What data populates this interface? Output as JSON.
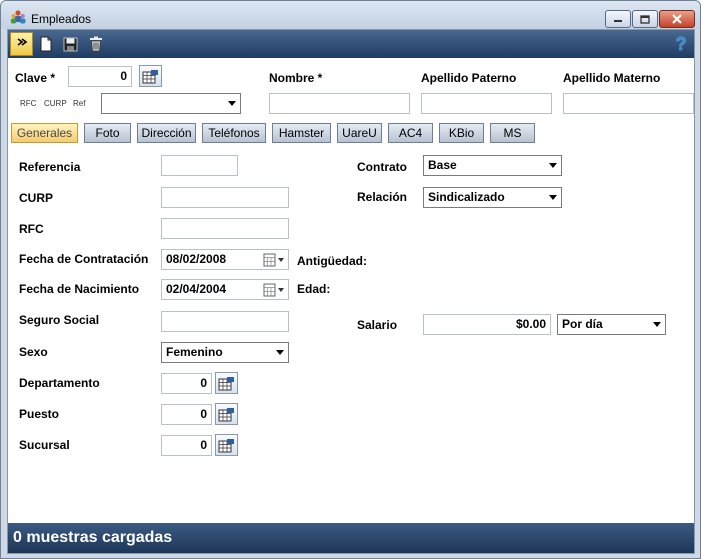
{
  "window": {
    "title": "Empleados"
  },
  "header": {
    "clave_label": "Clave *",
    "clave_value": "0",
    "nombre_label": "Nombre *",
    "apellido_paterno_label": "Apellido Paterno",
    "apellido_materno_label": "Apellido Materno",
    "rfc_tag": "RFC",
    "curp_tag": "CURP",
    "ref_tag": "Ref",
    "help_glyph": "?"
  },
  "tabs": [
    {
      "label": "Generales"
    },
    {
      "label": "Foto"
    },
    {
      "label": "Dirección"
    },
    {
      "label": "Teléfonos"
    },
    {
      "label": "Hamster"
    },
    {
      "label": "UareU"
    },
    {
      "label": "AC4"
    },
    {
      "label": "KBio"
    },
    {
      "label": "MS"
    }
  ],
  "form": {
    "referencia_label": "Referencia",
    "curp_label": "CURP",
    "rfc_label": "RFC",
    "fecha_contratacion_label": "Fecha de Contratación",
    "fecha_contratacion_value": "08/02/2008",
    "fecha_nacimiento_label": "Fecha de Nacimiento",
    "fecha_nacimiento_value": "02/04/2004",
    "seguro_social_label": "Seguro Social",
    "sexo_label": "Sexo",
    "sexo_value": "Femenino",
    "departamento_label": "Departamento",
    "departamento_value": "0",
    "puesto_label": "Puesto",
    "puesto_value": "0",
    "sucursal_label": "Sucursal",
    "sucursal_value": "0",
    "contrato_label": "Contrato",
    "contrato_value": "Base",
    "relacion_label": "Relación",
    "relacion_value": "Sindicalizado",
    "antiguedad_label": "Antigüedad:",
    "edad_label": "Edad:",
    "salario_label": "Salario",
    "salario_value": "$0.00",
    "periodo_value": "Por día"
  },
  "status": {
    "text": "0 muestras cargadas"
  },
  "icons": {
    "app": "people-icon",
    "expand": "double-chevron-icon",
    "new": "new-document-icon",
    "save": "floppy-disk-icon",
    "delete": "trash-icon",
    "help": "help-icon",
    "lookup": "lookup-table-icon",
    "calendar": "calendar-icon"
  }
}
